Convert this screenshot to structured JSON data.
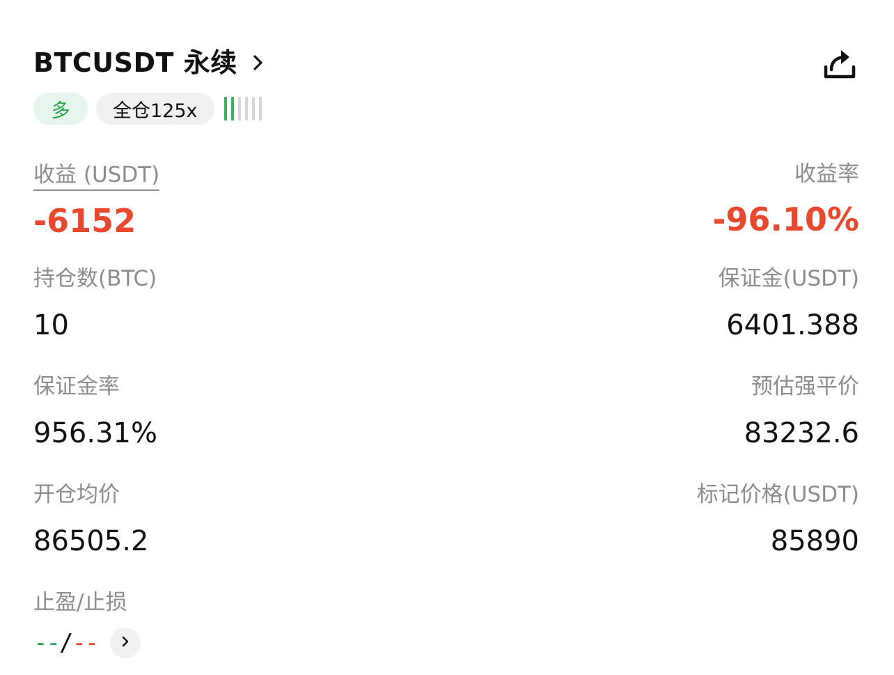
{
  "header": {
    "title": "BTCUSDT 永续",
    "icons": {
      "title_chevron": "chevron-right-icon",
      "share": "share-icon"
    }
  },
  "tags": {
    "side": "多",
    "margin_mode": "全仓125x",
    "leverage_level": {
      "active": 2,
      "total": 6
    }
  },
  "colors": {
    "profit_green": "#2aa44f",
    "loss_red": "#e8482d",
    "label_gray": "#8c8c8c"
  },
  "stats": {
    "pnl": {
      "label": "收益 (USDT)",
      "value": "-6152"
    },
    "pnl_rate": {
      "label": "收益率",
      "value": "-96.10%"
    },
    "position_size": {
      "label": "持仓数(BTC)",
      "value": "10"
    },
    "margin": {
      "label": "保证金(USDT)",
      "value": "6401.388"
    },
    "margin_ratio": {
      "label": "保证金率",
      "value": "956.31%"
    },
    "liq_price": {
      "label": "预估强平价",
      "value": "83232.6"
    },
    "entry_price": {
      "label": "开仓均价",
      "value": "86505.2"
    },
    "mark_price": {
      "label": "标记价格(USDT)",
      "value": "85890"
    }
  },
  "tpsl": {
    "label": "止盈/止损",
    "take_profit": "--",
    "separator": "/",
    "stop_loss": "--"
  }
}
